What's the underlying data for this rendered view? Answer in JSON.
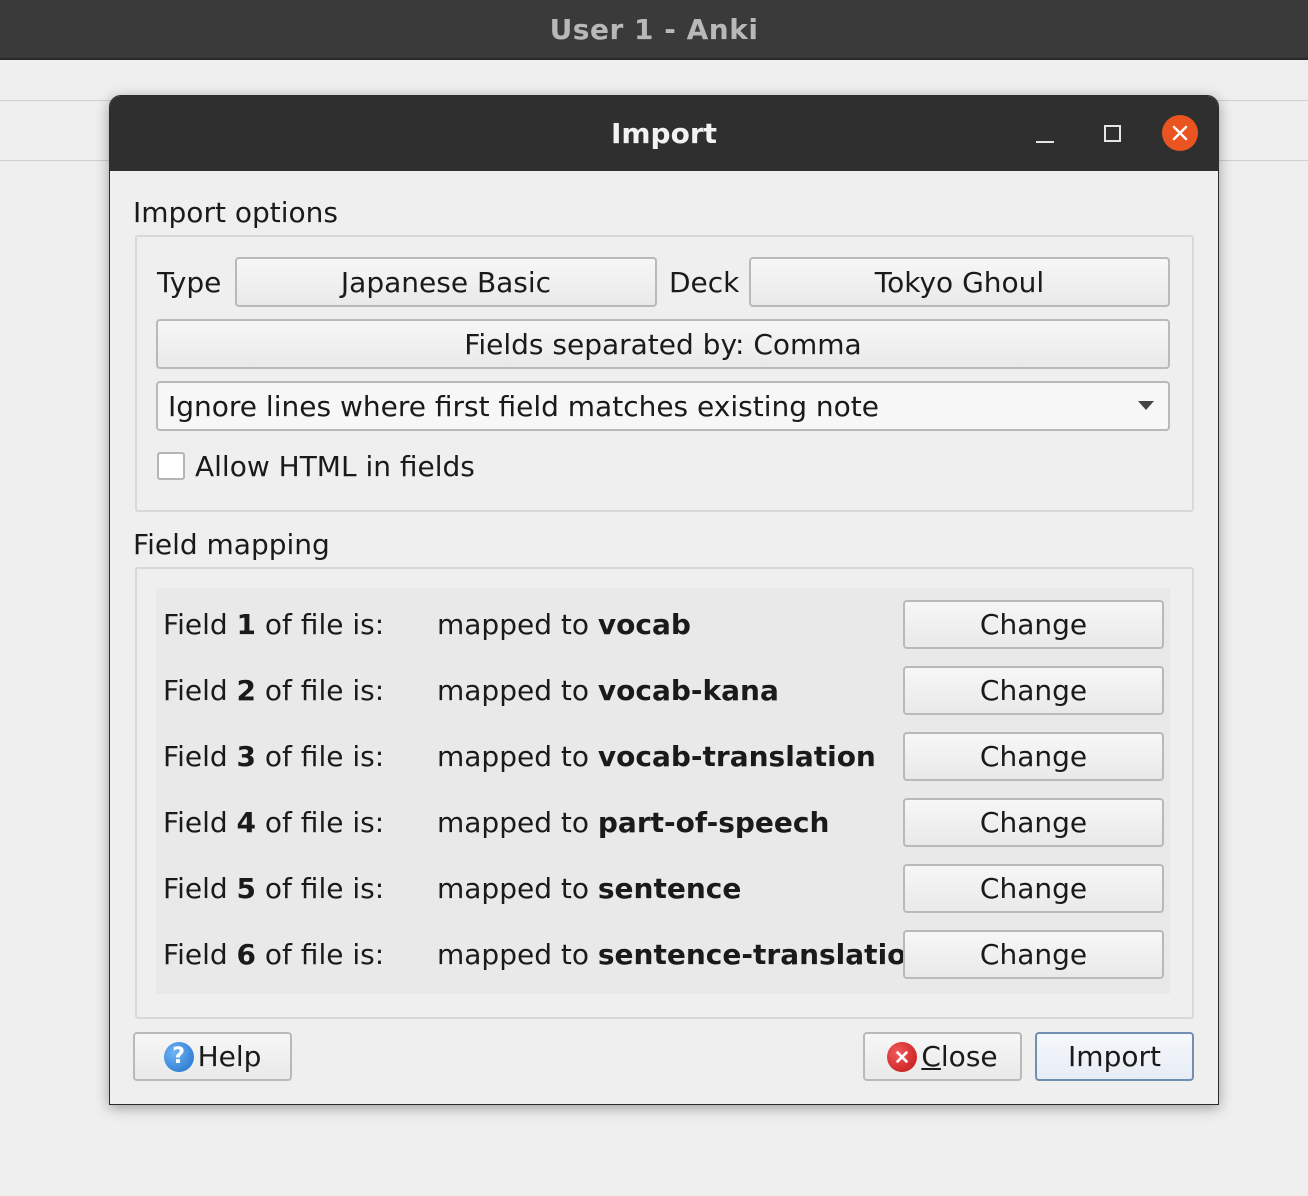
{
  "app": {
    "title": "User 1 - Anki"
  },
  "dialog": {
    "title": "Import",
    "import_options": {
      "label": "Import options",
      "type_label": "Type",
      "type_value": "Japanese Basic",
      "deck_label": "Deck",
      "deck_value": "Tokyo Ghoul",
      "separator_button": "Fields separated by: Comma",
      "duplicate_mode": "Ignore lines where first field matches existing note",
      "allow_html_label": "Allow HTML in fields",
      "allow_html_checked": false
    },
    "field_mapping": {
      "label": "Field mapping",
      "rows": [
        {
          "prefix": "Field ",
          "index": "1",
          "suffix": " of file is:",
          "mapped_prefix": "mapped to ",
          "field": "vocab",
          "button": "Change"
        },
        {
          "prefix": "Field ",
          "index": "2",
          "suffix": " of file is:",
          "mapped_prefix": "mapped to ",
          "field": "vocab-kana",
          "button": "Change"
        },
        {
          "prefix": "Field ",
          "index": "3",
          "suffix": " of file is:",
          "mapped_prefix": "mapped to ",
          "field": "vocab-translation",
          "button": "Change"
        },
        {
          "prefix": "Field ",
          "index": "4",
          "suffix": " of file is:",
          "mapped_prefix": "mapped to ",
          "field": "part-of-speech",
          "button": "Change"
        },
        {
          "prefix": "Field ",
          "index": "5",
          "suffix": " of file is:",
          "mapped_prefix": "mapped to ",
          "field": "sentence",
          "button": "Change"
        },
        {
          "prefix": "Field ",
          "index": "6",
          "suffix": " of file is:",
          "mapped_prefix": "mapped to ",
          "field": "sentence-translation",
          "button": "Change"
        }
      ]
    },
    "buttons": {
      "help": "Help",
      "close": "Close",
      "import": "Import"
    },
    "icons": {
      "help": "help-icon",
      "close": "cancel-icon",
      "window_close": "close-icon"
    },
    "colors": {
      "window_close_bg": "#e95420",
      "titlebar_bg": "#2f2f2f"
    }
  }
}
